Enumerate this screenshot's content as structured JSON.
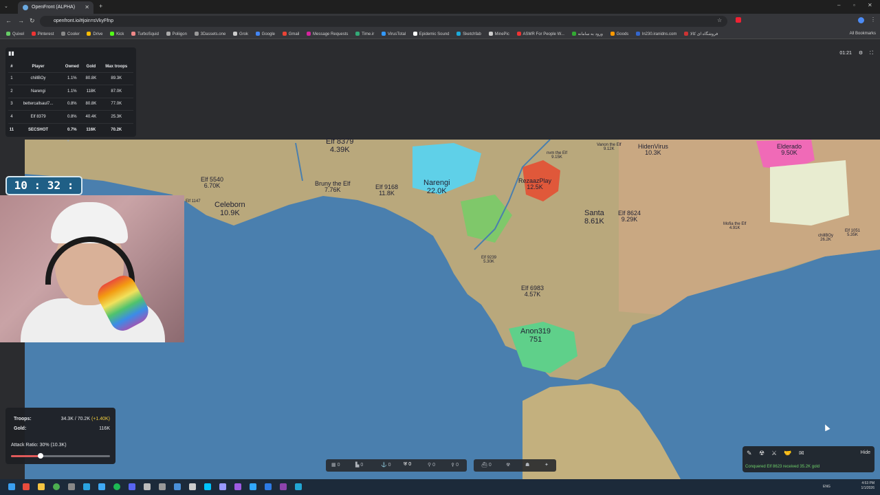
{
  "browser": {
    "tab_title": "OpenFront (ALPHA)",
    "url": "openfront.io/#join=sVkyFfnp",
    "bookmarks": [
      "Quixel",
      "Pinterest",
      "Cooler",
      "Drive",
      "Kick",
      "TurboSquid",
      "Poliigon",
      "3Dassets.one",
      "Grok",
      "Google",
      "Gmail",
      "Message Requests",
      "Time.ir",
      "VirusTotal",
      "Epidemic Sound",
      "Sketchfab",
      "MinePic",
      "ASMR For People W...",
      "ورود به سامانه",
      "Goods",
      "ln230.iranidns.com",
      "فروشگاه ای کالا"
    ],
    "all_bookmarks": "All Bookmarks"
  },
  "leaderboard": {
    "headers": [
      "#",
      "Player",
      "Owned",
      "Gold",
      "Max troops"
    ],
    "rows": [
      {
        "rank": "1",
        "player": "chillBOy",
        "owned": "1.1%",
        "gold": "80.8K",
        "troops": "89.3K"
      },
      {
        "rank": "2",
        "player": "Narengi",
        "owned": "1.1%",
        "gold": "118K",
        "troops": "87.0K"
      },
      {
        "rank": "3",
        "player": "bettercallsaul7...",
        "owned": "0.8%",
        "gold": "80.8K",
        "troops": "77.0K"
      },
      {
        "rank": "4",
        "player": "Elf 8379",
        "owned": "0.8%",
        "gold": "40.4K",
        "troops": "25.3K"
      },
      {
        "rank": "11",
        "player": "SECSHOT",
        "owned": "0.7%",
        "gold": "116K",
        "troops": "70.2K"
      }
    ],
    "more": "+"
  },
  "game_timer": "01:21",
  "clock_overlay": "10 : 32 : 05",
  "map_labels": [
    {
      "name": "Elf 8379",
      "value": "4.39K",
      "size": "big"
    },
    {
      "name": "Narengi",
      "value": "22.0K",
      "size": "big"
    },
    {
      "name": "RezaazPlay",
      "value": "12.5K",
      "size": "med"
    },
    {
      "name": "Elderado",
      "value": "9.50K",
      "size": "med"
    },
    {
      "name": "Elf 5540",
      "value": "6.70K",
      "size": "med"
    },
    {
      "name": "Celeborn",
      "value": "10.9K",
      "size": "big"
    },
    {
      "name": "Bruny the Elf",
      "value": "7.76K",
      "size": "med"
    },
    {
      "name": "Elf 9168",
      "value": "11.8K",
      "size": "med"
    },
    {
      "name": "Santa",
      "value": "8.61K",
      "size": "big"
    },
    {
      "name": "Elf 8624",
      "value": "9.29K",
      "size": "med"
    },
    {
      "name": "HidenVirus",
      "value": "10.3K",
      "size": "med"
    },
    {
      "name": "Vanon the Elf",
      "value": "9.12K",
      "size": "med"
    },
    {
      "name": "Elf 6983",
      "value": "4.57K",
      "size": "med"
    },
    {
      "name": "Elf 9239",
      "value": "5.30K",
      "size": "med"
    },
    {
      "name": "Anon319",
      "value": "751",
      "size": "big"
    },
    {
      "name": "Mofia the Elf",
      "value": "4.91K",
      "size": "med"
    },
    {
      "name": "chillBOy",
      "value": "26.2K",
      "size": "sm"
    },
    {
      "name": "Elf 1051",
      "value": "5.35K",
      "size": "sm"
    },
    {
      "name": "nvm the Elf",
      "value": "9.15K",
      "size": "sm"
    },
    {
      "name": "Elf 1147",
      "value": "",
      "size": "sm"
    }
  ],
  "stats": {
    "troops_label": "Troops:",
    "troops_value": "34.3K / 70.2K",
    "troops_delta": "(+1.40K)",
    "gold_label": "Gold:",
    "gold_value": "116K",
    "attack_label": "Attack Ratio: 30% (10.3K)",
    "attack_ratio": 0.3
  },
  "build_counts": [
    "0",
    "0",
    "0",
    "0",
    "0",
    "0",
    "0"
  ],
  "actions": {
    "hide": "Hide",
    "message": "Conquered Elf 8623 received 35.2K gold"
  },
  "taskbar": {
    "lang": "ENG",
    "time": "4:53 PM",
    "date": "1/1/2026"
  },
  "colors": {
    "ocean": "#4a7fae",
    "narengi": "#5fd0e8",
    "rezaaz": "#e0583a",
    "elderado": "#f06ab7",
    "anon": "#5fd08a",
    "message": "#6fd16a"
  }
}
